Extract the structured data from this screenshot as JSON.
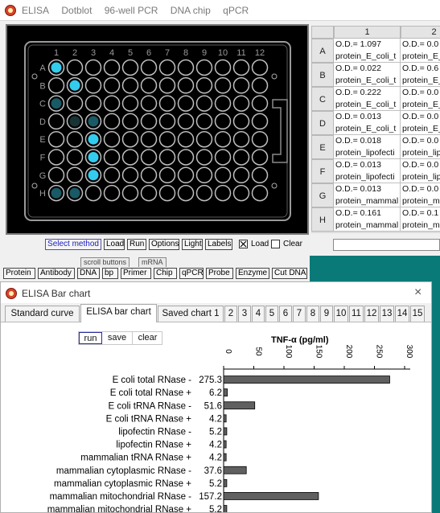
{
  "main_window": {
    "menu": [
      "ELISA",
      "Dotblot",
      "96-well PCR",
      "DNA chip",
      "qPCR"
    ]
  },
  "plate": {
    "columns": [
      "1",
      "2",
      "3",
      "4",
      "5",
      "6",
      "7",
      "8",
      "9",
      "10",
      "11",
      "12"
    ],
    "rows": [
      "A",
      "B",
      "C",
      "D",
      "E",
      "F",
      "G",
      "H"
    ],
    "colors": {
      "bright": "#33ccee",
      "dim": "#1a5a66",
      "dark": "#173336",
      "ring": "#bfbfbf"
    },
    "signals": [
      {
        "row": "A",
        "col": 1,
        "level": "bright"
      },
      {
        "row": "B",
        "col": 2,
        "level": "bright"
      },
      {
        "row": "C",
        "col": 1,
        "level": "dim"
      },
      {
        "row": "D",
        "col": 2,
        "level": "dark"
      },
      {
        "row": "D",
        "col": 3,
        "level": "dim"
      },
      {
        "row": "E",
        "col": 3,
        "level": "bright"
      },
      {
        "row": "F",
        "col": 3,
        "level": "bright"
      },
      {
        "row": "G",
        "col": 3,
        "level": "bright"
      },
      {
        "row": "H",
        "col": 1,
        "level": "dim"
      },
      {
        "row": "H",
        "col": 2,
        "level": "dim"
      }
    ]
  },
  "od_table": {
    "col_headers": [
      "1",
      "2"
    ],
    "rows": [
      {
        "label": "A",
        "c1_od": "O.D.= 1.097",
        "c1_name": "protein_E_coli_t",
        "c2_od": "O.D.= 0.0",
        "c2_name": "protein_E_"
      },
      {
        "label": "B",
        "c1_od": "O.D.= 0.022",
        "c1_name": "protein_E_coli_t",
        "c2_od": "O.D.= 0.6",
        "c2_name": "protein_E_"
      },
      {
        "label": "C",
        "c1_od": "O.D.= 0.222",
        "c1_name": "protein_E_coli_t",
        "c2_od": "O.D.= 0.0",
        "c2_name": "protein_E_"
      },
      {
        "label": "D",
        "c1_od": "O.D.= 0.013",
        "c1_name": "protein_E_coli_t",
        "c2_od": "O.D.= 0.0",
        "c2_name": "protein_E_"
      },
      {
        "label": "E",
        "c1_od": "O.D.= 0.018",
        "c1_name": "protein_lipofecti",
        "c2_od": "O.D.= 0.0",
        "c2_name": "protein_lip"
      },
      {
        "label": "F",
        "c1_od": "O.D.= 0.013",
        "c1_name": "protein_lipofecti",
        "c2_od": "O.D.= 0.0",
        "c2_name": "protein_lip"
      },
      {
        "label": "G",
        "c1_od": "O.D.= 0.013",
        "c1_name": "protein_mammal",
        "c2_od": "O.D.= 0.0",
        "c2_name": "protein_ma"
      },
      {
        "label": "H",
        "c1_od": "O.D.= 0.161",
        "c1_name": "protein_mammal",
        "c2_od": "O.D.= 0.1",
        "c2_name": "protein_ma"
      }
    ]
  },
  "bottom_bar": {
    "select_method": "Select method",
    "load": "Load",
    "run": "Run",
    "options": "Options",
    "light": "Light",
    "labels": "Labels",
    "load_check": "Load",
    "clear_check": "Clear"
  },
  "tool_panel": {
    "tabs": [
      "scroll buttons",
      "mRNA"
    ],
    "buttons": [
      "Protein",
      "Antibody",
      "DNA",
      "bp",
      "Primer",
      "Chip",
      "qPCR",
      "Probe",
      "Enzyme",
      "Cut DNA"
    ]
  },
  "chart_window": {
    "title": "ELISA Bar chart",
    "close": "×",
    "tabs": [
      "Standard curve",
      "ELISA bar chart",
      "Saved chart 1",
      "2",
      "3",
      "4",
      "5",
      "6",
      "7",
      "8",
      "9",
      "10",
      "11",
      "12",
      "13",
      "14",
      "15"
    ],
    "actions": {
      "run": "run",
      "save": "save",
      "clear": "clear"
    }
  },
  "chart_data": {
    "type": "bar",
    "orientation": "horizontal",
    "title": "TNF-α (pg/ml)",
    "xlabel": "",
    "ylabel": "",
    "xlim": [
      0,
      300
    ],
    "xticks": [
      "0",
      "50",
      "100",
      "150",
      "200",
      "250",
      "300"
    ],
    "xtick_values": [
      0,
      50,
      100,
      150,
      200,
      250,
      300
    ],
    "bar_color": "#606060",
    "categories": [
      "E coli total RNase -",
      "E coli total RNase +",
      "E coli tRNA RNase -",
      "E coli tRNA RNase +",
      "lipofectin RNase -",
      "lipofectin RNase +",
      "mammalian  tRNA RNase +",
      "mammalian cytoplasmic RNase -",
      "mammalian cytoplasmic RNase +",
      "mammalian mitochondrial RNase -",
      "mammalian mitochondrial RNase +"
    ],
    "values": [
      275.3,
      6.2,
      51.6,
      4.2,
      5.2,
      4.2,
      4.2,
      37.6,
      5.2,
      157.2,
      5.2
    ],
    "value_labels": [
      "275.3",
      "6.2",
      "51.6",
      "4.2",
      "5.2",
      "4.2",
      "4.2",
      "37.6",
      "5.2",
      "157.2",
      "5.2"
    ]
  }
}
